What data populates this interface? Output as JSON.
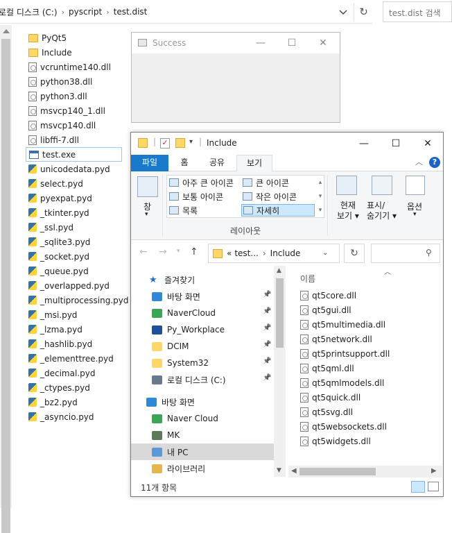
{
  "back_window": {
    "breadcrumb": [
      "로컬 디스크 (C:)",
      "pyscript",
      "test.dist"
    ],
    "search_placeholder": "test.dist 검색",
    "files": [
      {
        "name": "PyQt5",
        "type": "folder"
      },
      {
        "name": "Include",
        "type": "folder"
      },
      {
        "name": "vcruntime140.dll",
        "type": "dll"
      },
      {
        "name": "python38.dll",
        "type": "dll"
      },
      {
        "name": "python3.dll",
        "type": "dll"
      },
      {
        "name": "msvcp140_1.dll",
        "type": "dll"
      },
      {
        "name": "msvcp140.dll",
        "type": "dll"
      },
      {
        "name": "libffi-7.dll",
        "type": "dll"
      },
      {
        "name": "test.exe",
        "type": "exe",
        "selected": true
      },
      {
        "name": "unicodedata.pyd",
        "type": "pyd"
      },
      {
        "name": "select.pyd",
        "type": "pyd"
      },
      {
        "name": "pyexpat.pyd",
        "type": "pyd"
      },
      {
        "name": "_tkinter.pyd",
        "type": "pyd"
      },
      {
        "name": "_ssl.pyd",
        "type": "pyd"
      },
      {
        "name": "_sqlite3.pyd",
        "type": "pyd"
      },
      {
        "name": "_socket.pyd",
        "type": "pyd"
      },
      {
        "name": "_queue.pyd",
        "type": "pyd"
      },
      {
        "name": "_overlapped.pyd",
        "type": "pyd"
      },
      {
        "name": "_multiprocessing.pyd",
        "type": "pyd"
      },
      {
        "name": "_msi.pyd",
        "type": "pyd"
      },
      {
        "name": "_lzma.pyd",
        "type": "pyd"
      },
      {
        "name": "_hashlib.pyd",
        "type": "pyd"
      },
      {
        "name": "_elementtree.pyd",
        "type": "pyd"
      },
      {
        "name": "_decimal.pyd",
        "type": "pyd"
      },
      {
        "name": "_ctypes.pyd",
        "type": "pyd"
      },
      {
        "name": "_bz2.pyd",
        "type": "pyd"
      },
      {
        "name": "_asyncio.pyd",
        "type": "pyd"
      }
    ]
  },
  "success_dialog": {
    "title": "Success"
  },
  "explorer": {
    "title": "Include",
    "tabs": {
      "file": "파일",
      "home": "홈",
      "share": "공유",
      "view": "보기"
    },
    "ribbon": {
      "pane_label": "창",
      "layout_items": [
        "아주 큰 아이콘",
        "큰 아이콘",
        "보통 아이콘",
        "작은 아이콘",
        "목록",
        "자세히"
      ],
      "layout_group": "레이아웃",
      "current_view_line1": "현재",
      "current_view_line2": "보기",
      "show_hide_line1": "표시/",
      "show_hide_line2": "숨기기",
      "options": "옵션"
    },
    "address": {
      "prefix": "«",
      "parent": "test...",
      "current": "Include"
    },
    "nav_pane": [
      {
        "label": "즐겨찾기",
        "icon": "star-icon",
        "pinned": false
      },
      {
        "label": "바탕 화면",
        "icon": "desktop-icon",
        "pinned": true
      },
      {
        "label": "NaverCloud",
        "icon": "cloud-folder-icon",
        "pinned": true
      },
      {
        "label": "Py_Workplace",
        "icon": "terminal-icon",
        "pinned": true
      },
      {
        "label": "DCIM",
        "icon": "folder-icon",
        "pinned": true
      },
      {
        "label": "System32",
        "icon": "folder-icon",
        "pinned": true
      },
      {
        "label": "로컬 디스크 (C:)",
        "icon": "drive-icon",
        "pinned": true
      },
      {
        "label": "바탕 화면",
        "icon": "desktop-icon",
        "pinned": false
      },
      {
        "label": "Naver Cloud",
        "icon": "cloud-folder-icon",
        "pinned": false
      },
      {
        "label": "MK",
        "icon": "user-icon",
        "pinned": false
      },
      {
        "label": "내 PC",
        "icon": "pc-icon",
        "pinned": false,
        "selected": true
      },
      {
        "label": "라이브러리",
        "icon": "library-icon",
        "pinned": false
      }
    ],
    "column_header": "이름",
    "files": [
      "qt5core.dll",
      "qt5gui.dll",
      "qt5multimedia.dll",
      "qt5network.dll",
      "qt5printsupport.dll",
      "qt5qml.dll",
      "qt5qmlmodels.dll",
      "qt5quick.dll",
      "qt5svg.dll",
      "qt5websockets.dll",
      "qt5widgets.dll"
    ],
    "status": "11개 항목"
  }
}
